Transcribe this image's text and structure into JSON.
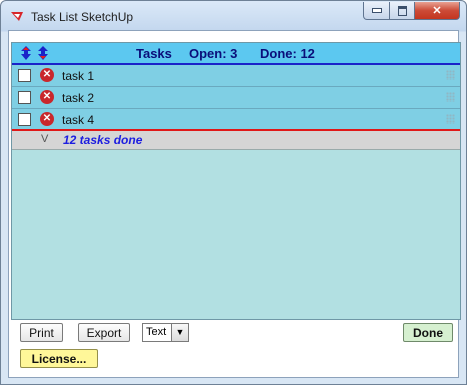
{
  "window": {
    "title": "Task List SketchUp"
  },
  "header": {
    "title": "Tasks",
    "open_label": "Open: 3",
    "done_label": "Done: 12"
  },
  "tasks": [
    {
      "label": "task 1"
    },
    {
      "label": "task 2"
    },
    {
      "label": "task 4"
    }
  ],
  "done_bar": {
    "chevron": "V",
    "text": "12 tasks done"
  },
  "footer": {
    "print_label": "Print",
    "export_label": "Export",
    "format_value": "Text",
    "done_label": "Done",
    "license_label": "License..."
  },
  "colors": {
    "header_bg": "#5cc8f0",
    "task_row_bg": "#7fcfe4",
    "panel_bg": "#b2e0e2",
    "done_text": "#1d1de0",
    "accent_red": "#e01818"
  },
  "icons": {
    "app": "sketchup-logo-icon",
    "move_up": "move-up-icon",
    "move_down": "move-down-icon",
    "delete": "delete-x-icon",
    "drag": "drag-handle-icon"
  }
}
